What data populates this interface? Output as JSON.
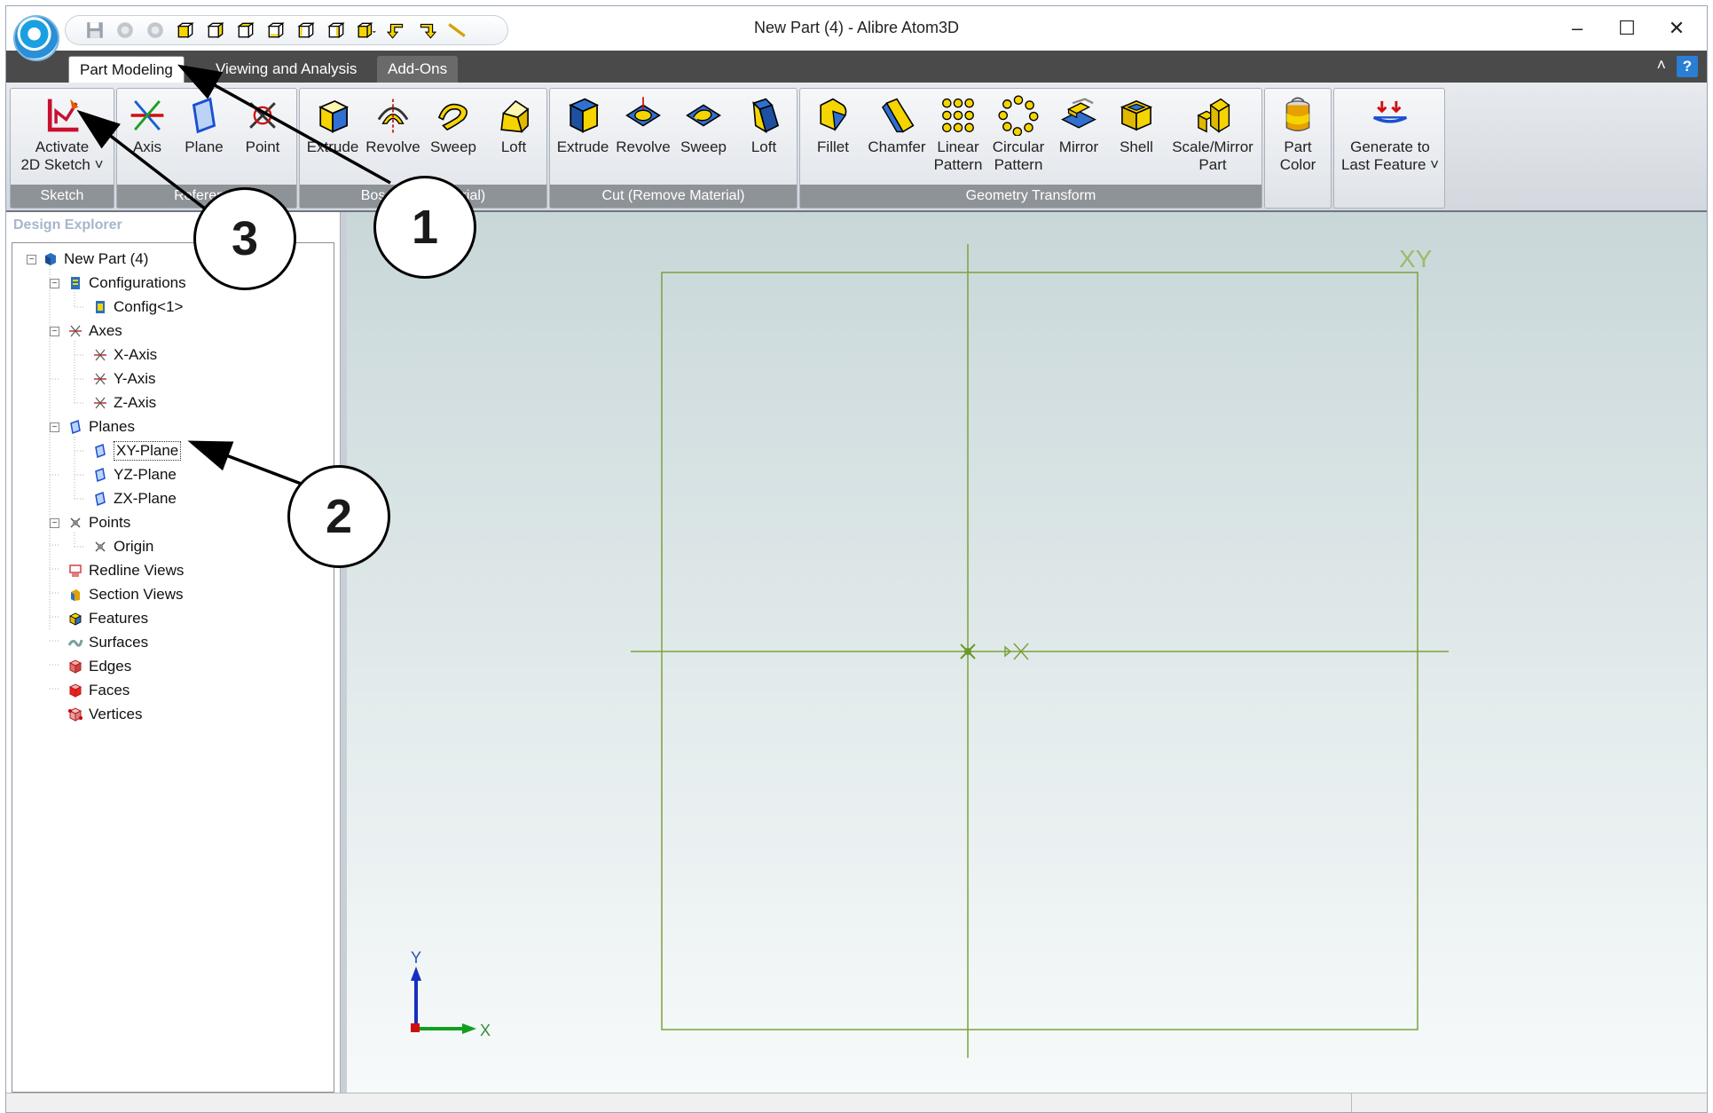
{
  "window": {
    "title": "New Part (4) - Alibre Atom3D",
    "minimize": "–",
    "maximize": "☐",
    "close": "✕"
  },
  "qat": [
    "save-icon",
    "undo-icon",
    "redo-icon",
    "cube-icon",
    "cube-icon",
    "cube-icon",
    "cube-icon",
    "cube-icon",
    "cube-icon",
    "cube-dropdown-icon",
    "arrow-down-left-icon",
    "arrow-down-right-icon",
    "line-icon"
  ],
  "tabs": {
    "part_modeling": "Part Modeling",
    "viewing": "Viewing and Analysis",
    "addons": "Add-Ons",
    "collapse": "˄",
    "help": "?"
  },
  "ribbon": {
    "sketch": {
      "label": "Sketch",
      "activate_line1": "Activate",
      "activate_line2": "2D Sketch ˅"
    },
    "reference": {
      "label": "Reference",
      "axis": "Axis",
      "plane": "Plane",
      "point": "Point"
    },
    "boss": {
      "label": "Boss (Add Material)",
      "extrude": "Extrude",
      "revolve": "Revolve",
      "sweep": "Sweep",
      "loft": "Loft"
    },
    "cut": {
      "label": "Cut (Remove Material)",
      "extrude": "Extrude",
      "revolve": "Revolve",
      "sweep": "Sweep",
      "loft": "Loft"
    },
    "geometry": {
      "label": "Geometry Transform",
      "fillet": "Fillet",
      "chamfer": "Chamfer",
      "linear_1": "Linear",
      "linear_2": "Pattern",
      "circular_1": "Circular",
      "circular_2": "Pattern",
      "mirror": "Mirror",
      "shell": "Shell",
      "scale_1": "Scale/Mirror",
      "scale_2": "Part"
    },
    "color": {
      "part_1": "Part",
      "part_2": "Color"
    },
    "generate": {
      "line1": "Generate to",
      "line2": "Last Feature ˅"
    }
  },
  "explorer": {
    "title": "Design Explorer",
    "root": "New Part (4)",
    "configurations": "Configurations",
    "config1": "Config<1>",
    "axes": "Axes",
    "x_axis": "X-Axis",
    "y_axis": "Y-Axis",
    "z_axis": "Z-Axis",
    "planes": "Planes",
    "xy_plane": "XY-Plane",
    "yz_plane": "YZ-Plane",
    "zx_plane": "ZX-Plane",
    "points": "Points",
    "origin": "Origin",
    "redline": "Redline Views",
    "section": "Section Views",
    "features": "Features",
    "surfaces": "Surfaces",
    "edges": "Edges",
    "faces": "Faces",
    "vertices": "Vertices"
  },
  "viewport": {
    "plane_label": "XY",
    "triad_y": "Y",
    "triad_x": "X"
  },
  "callouts": [
    "1",
    "2",
    "3"
  ],
  "colors": {
    "plane_line": "#7aa23c",
    "tab_strip": "#4a4a4a",
    "group_label_bg": "#8e9398"
  }
}
